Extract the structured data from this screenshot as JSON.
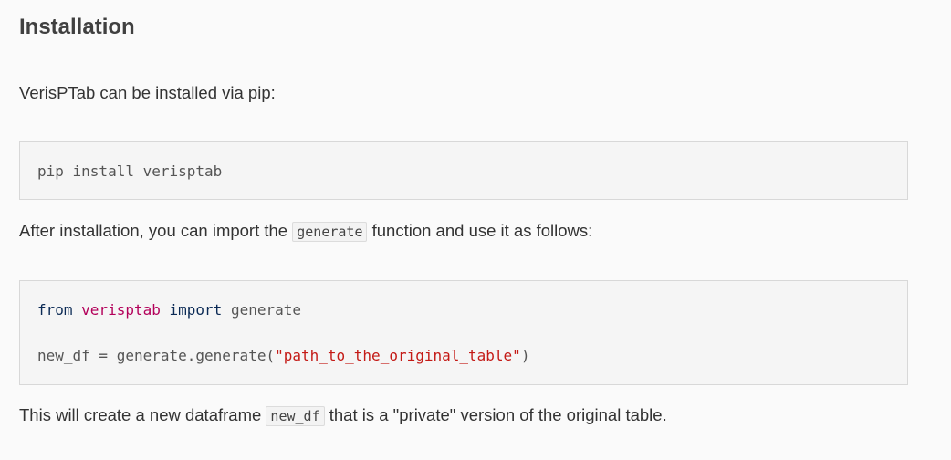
{
  "section": {
    "title": "Installation"
  },
  "intro": {
    "text": "VerisPTab can be installed via pip:"
  },
  "install_code": {
    "line": "pip install verisptab"
  },
  "usage_intro": {
    "before": "After installation, you can import the ",
    "code": "generate",
    "after": " function and use it as follows:"
  },
  "usage_code": {
    "line1": {
      "kw_from": "from",
      "module": "verisptab",
      "kw_import": "import",
      "name": "generate"
    },
    "line2": {
      "prefix": "new_df = generate.generate(",
      "string": "\"path_to_the_original_table\"",
      "suffix": ")"
    }
  },
  "outro": {
    "before": "This will create a new dataframe ",
    "code": "new_df",
    "after": " that is a \"private\" version of the original table."
  }
}
